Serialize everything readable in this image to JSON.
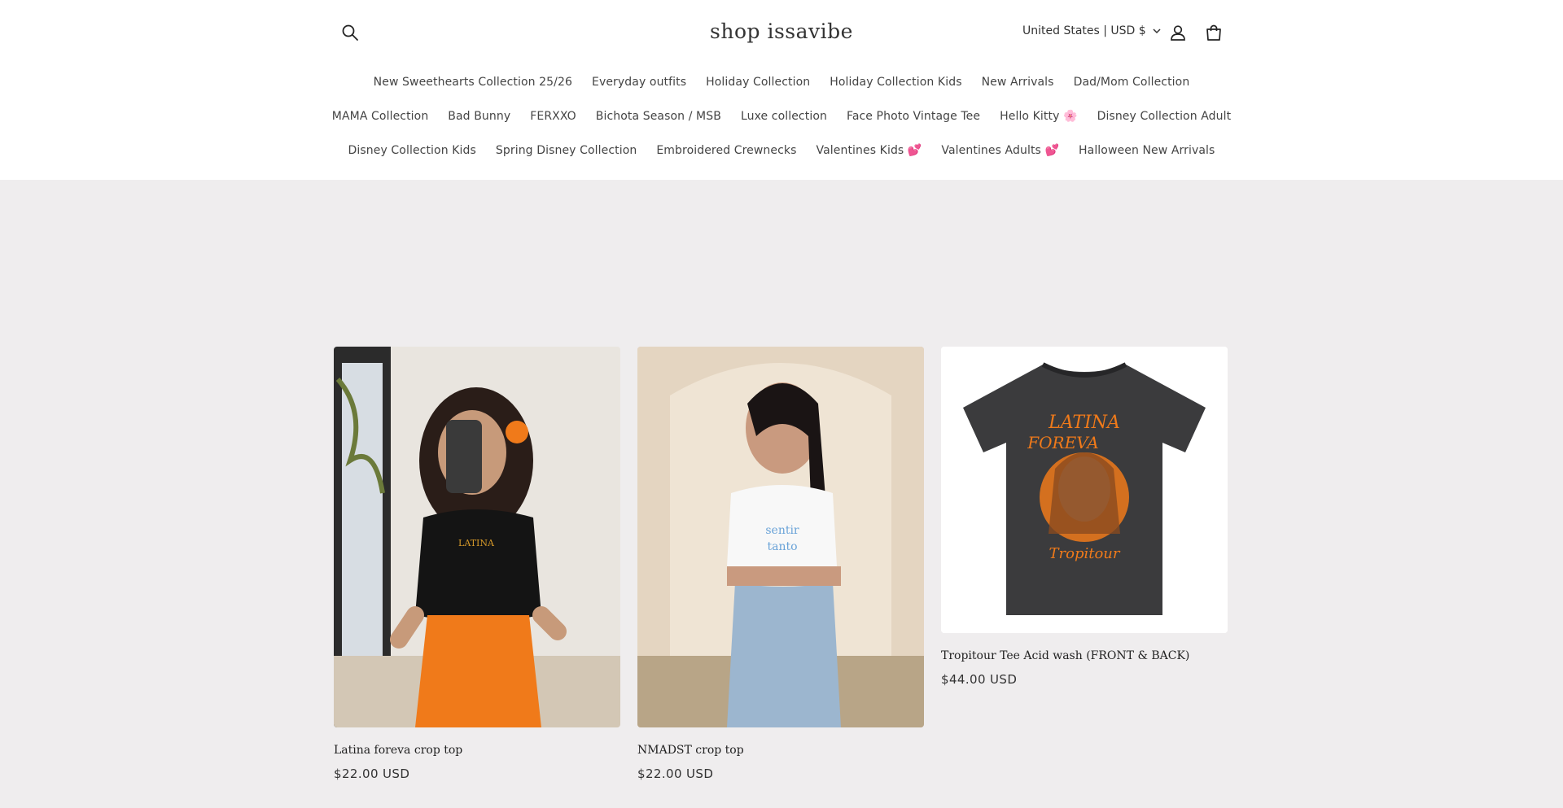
{
  "header": {
    "brand": "shop issavibe",
    "currency": "United States | USD $",
    "icons": [
      "search-icon",
      "account-icon",
      "cart-icon",
      "chevron-down-icon"
    ]
  },
  "nav": {
    "rows": [
      [
        "New Sweethearts Collection 25/26",
        "Everyday outfits",
        "Holiday Collection",
        "Holiday Collection Kids",
        "New Arrivals",
        "Dad/Mom Collection"
      ],
      [
        "MAMA Collection",
        "Bad Bunny",
        "FERXXO",
        "Bichota Season / MSB",
        "Luxe collection",
        "Face Photo Vintage Tee",
        "Hello Kitty 🌸",
        "Disney Collection Adult"
      ],
      [
        "Disney Collection Kids",
        "Spring Disney Collection",
        "Embroidered Crewnecks",
        "Valentines Kids 💕",
        "Valentines Adults 💕",
        "Halloween New Arrivals"
      ]
    ]
  },
  "products": [
    {
      "title": "Latina foreva crop top",
      "price": "$22.00 USD"
    },
    {
      "title": "NMADST crop top",
      "price": "$22.00 USD"
    },
    {
      "title": "Tropitour Tee Acid wash (FRONT & BACK)",
      "price": "$44.00 USD"
    }
  ],
  "colors": {
    "background": "#efedee",
    "header": "#ffffff",
    "text": "#2a2a2a",
    "accent_orange": "#f07a1a"
  }
}
